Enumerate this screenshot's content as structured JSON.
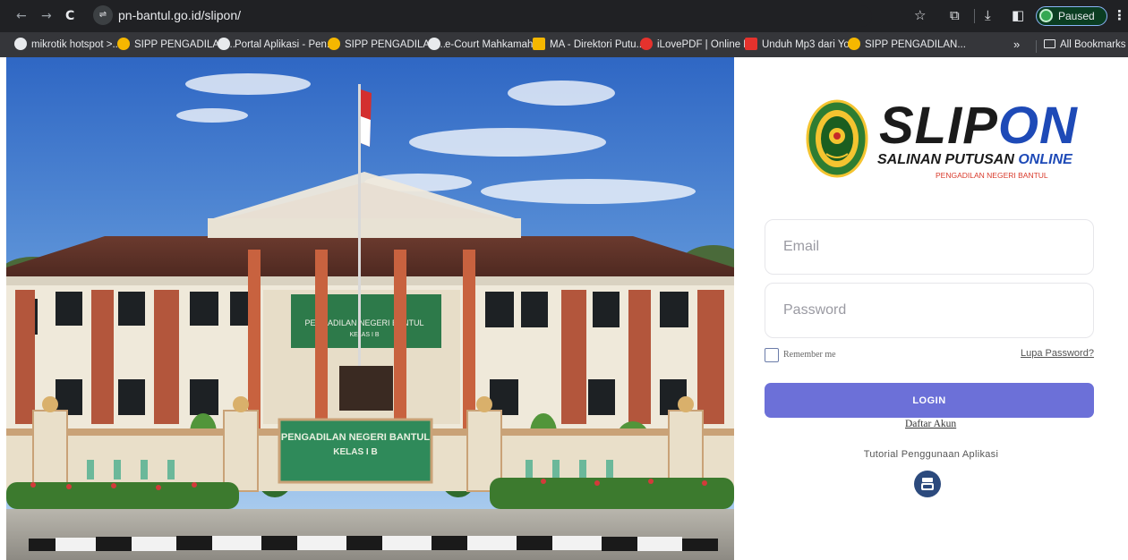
{
  "browser": {
    "url_domain": "pn-bantul.go.id",
    "url_path": "/slipon/",
    "profile_status": "Paused",
    "nav_back": "←",
    "nav_forward": "→",
    "nav_reload": "C"
  },
  "bookmarks": {
    "items": [
      {
        "label": "mikrotik hotspot >...",
        "color": "#e8eaed"
      },
      {
        "label": "SIPP PENGADILAN...",
        "color": "#f5b700"
      },
      {
        "label": "Portal Aplikasi - Pen...",
        "color": "#e8eaed"
      },
      {
        "label": "SIPP PENGADILAN...",
        "color": "#f5b700"
      },
      {
        "label": "e-Court Mahkamah...",
        "color": "#e8eaed"
      },
      {
        "label": "MA - Direktori Putu...",
        "color": "#f5b700"
      },
      {
        "label": "iLovePDF | Online P...",
        "color": "#e5322d"
      },
      {
        "label": "Unduh Mp3 dari Yo...",
        "color": "#e5322d"
      },
      {
        "label": "SIPP PENGADILAN...",
        "color": "#f5b700"
      }
    ],
    "more": "»",
    "all_bookmarks": "All Bookmarks"
  },
  "photo": {
    "building_sign": "PENGADILAN NEGERI BANTUL",
    "building_sign_class": "KELAS I B",
    "wall_sign": "PENGADILAN NEGERI BANTUL",
    "wall_sign_class": "KELAS I B"
  },
  "logo": {
    "title_a": "SLIP",
    "title_b": "ON",
    "subtitle_a": "SALINAN PUTUSAN ",
    "subtitle_b": "ONLINE",
    "court": "PENGADILAN NEGERI BANTUL"
  },
  "form": {
    "email_placeholder": "Email",
    "password_placeholder": "Password",
    "remember_label": "Remember me",
    "forgot_link": "Lupa Password?",
    "login_button": "LOGIN",
    "register_link": "Daftar Akun",
    "tutorial_text": "Tutorial Penggunaan Aplikasi"
  },
  "colors": {
    "accent": "#6c70d8",
    "brand_blue": "#1e4ab7",
    "court_red": "#d93a2b"
  }
}
